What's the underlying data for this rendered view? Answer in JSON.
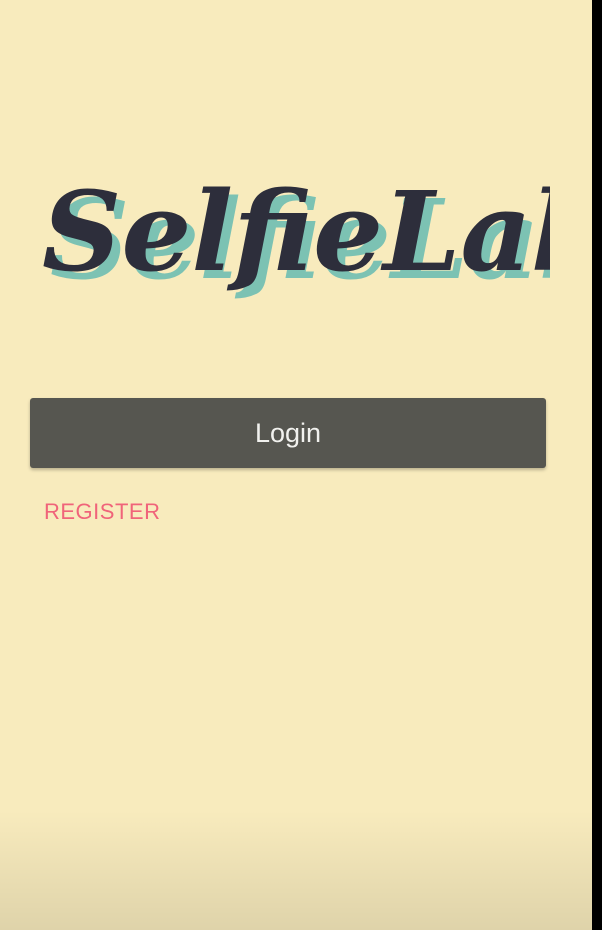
{
  "app": {
    "name": "SelfieLab"
  },
  "logo": {
    "text": "SelfieLab"
  },
  "actions": {
    "login_label": "Login",
    "register_label": "REGISTER"
  },
  "colors": {
    "background": "#f8ebbd",
    "logo_ink": "#2d2e3b",
    "logo_shadow": "#7cc2b3",
    "button_bg": "#565650",
    "button_text": "#f1f1ee",
    "register_text": "#f0647a"
  }
}
